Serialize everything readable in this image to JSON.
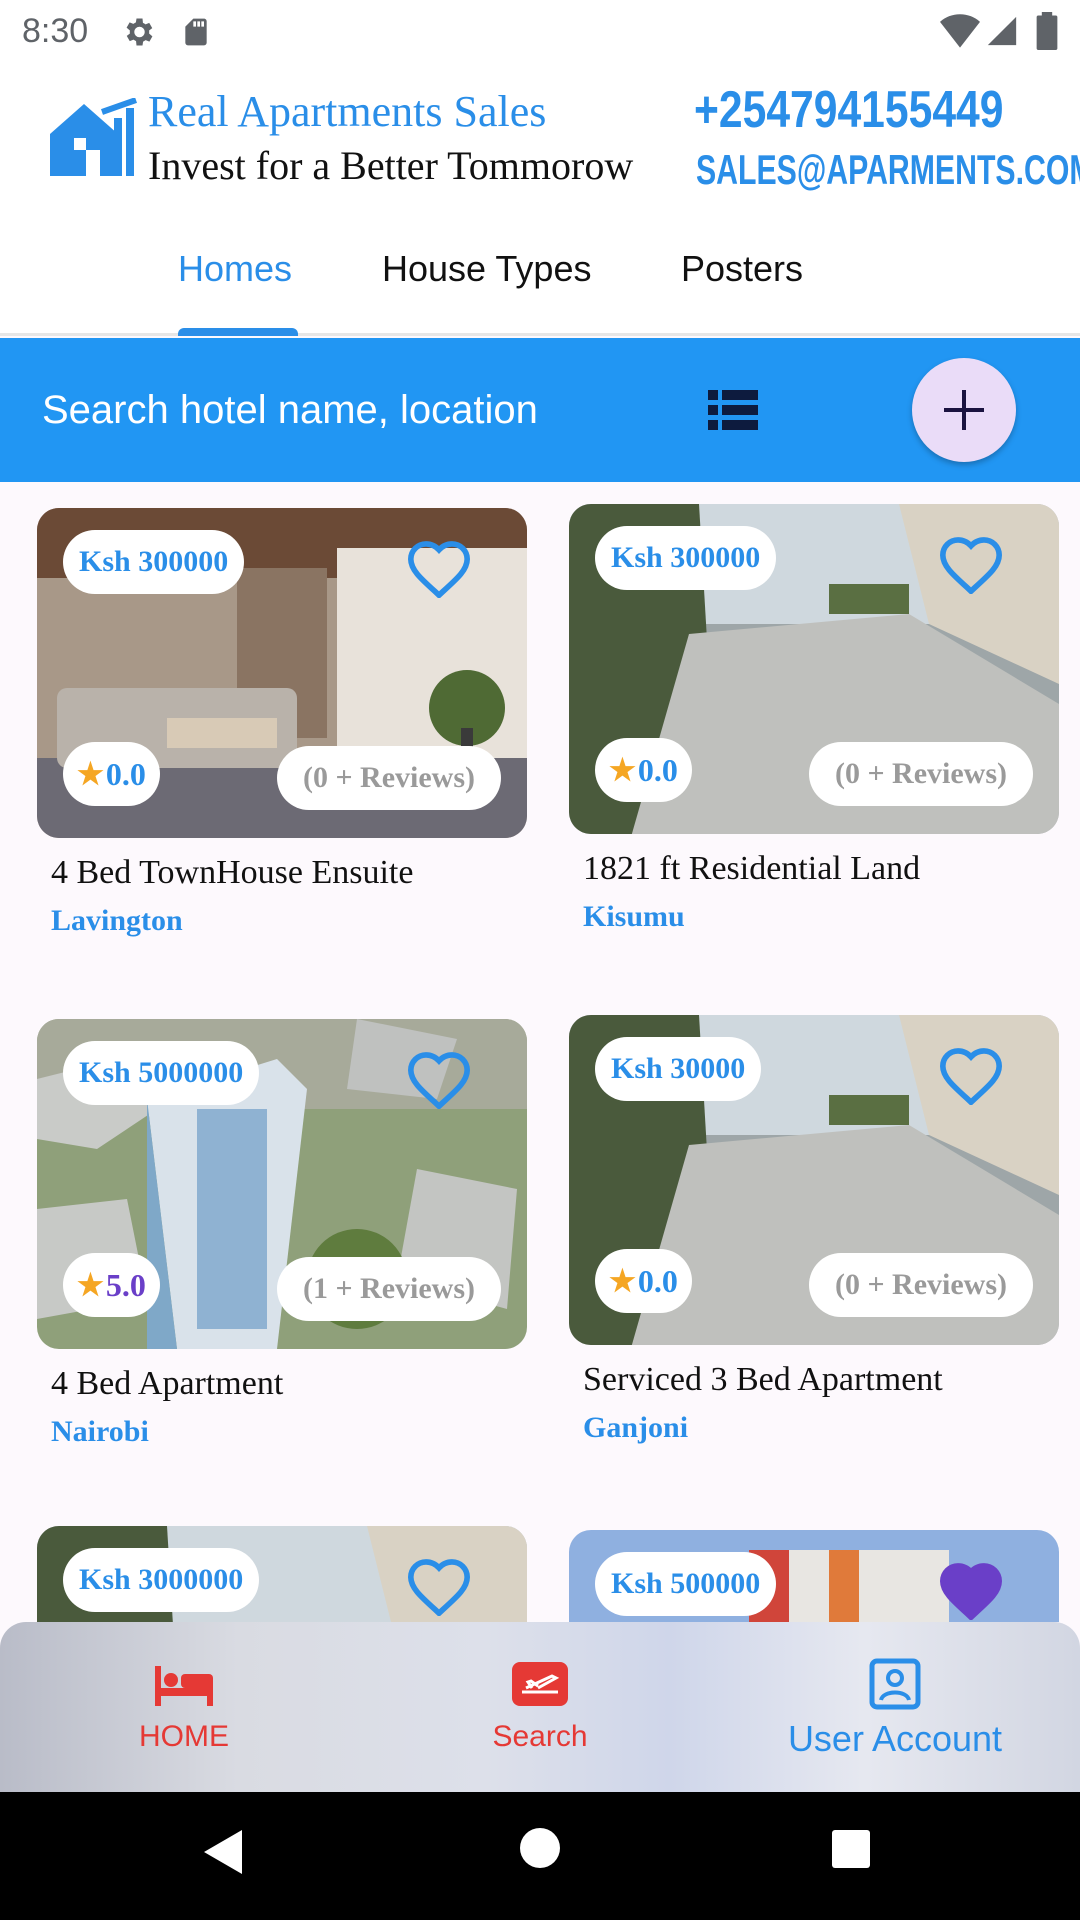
{
  "status_bar": {
    "time": "8:30"
  },
  "header": {
    "brand_title": "Real Apartments Sales",
    "tagline": "Invest for a Better Tommorow",
    "phone": "+254794155449",
    "email": "SALES@APARMENTS.COM"
  },
  "tabs": [
    {
      "label": "Homes",
      "active": true
    },
    {
      "label": "House Types",
      "active": false
    },
    {
      "label": "Posters",
      "active": false
    }
  ],
  "search": {
    "placeholder": "Search hotel name, location"
  },
  "listings": [
    {
      "price": "Ksh 300000",
      "rating": "0.0",
      "reviews": "(0 + Reviews)",
      "title": "4 Bed TownHouse Ensuite",
      "location": "Lavington",
      "favorite": false
    },
    {
      "price": "Ksh 300000",
      "rating": "0.0",
      "reviews": "(0 + Reviews)",
      "title": "1821 ft Residential Land",
      "location": "Kisumu",
      "favorite": false
    },
    {
      "price": "Ksh 5000000",
      "rating": "5.0",
      "reviews": "(1 + Reviews)",
      "title": "4 Bed Apartment",
      "location": "Nairobi",
      "favorite": false
    },
    {
      "price": "Ksh 30000",
      "rating": "0.0",
      "reviews": "(0 + Reviews)",
      "title": "Serviced 3 Bed Apartment",
      "location": "Ganjoni",
      "favorite": false
    },
    {
      "price": "Ksh 3000000",
      "favorite": false
    },
    {
      "price": "Ksh 500000",
      "favorite": true
    }
  ],
  "bottom_nav": [
    {
      "label": "HOME",
      "icon": "bed-icon"
    },
    {
      "label": "Search",
      "icon": "flight-icon"
    },
    {
      "label": "User Account",
      "icon": "account-box-icon"
    }
  ],
  "colors": {
    "accent": "#2a8ee8",
    "search_bar": "#2196f3",
    "fab": "#eadcf8",
    "nav_active": "#e53935",
    "favorite": "#6a3fc8"
  }
}
